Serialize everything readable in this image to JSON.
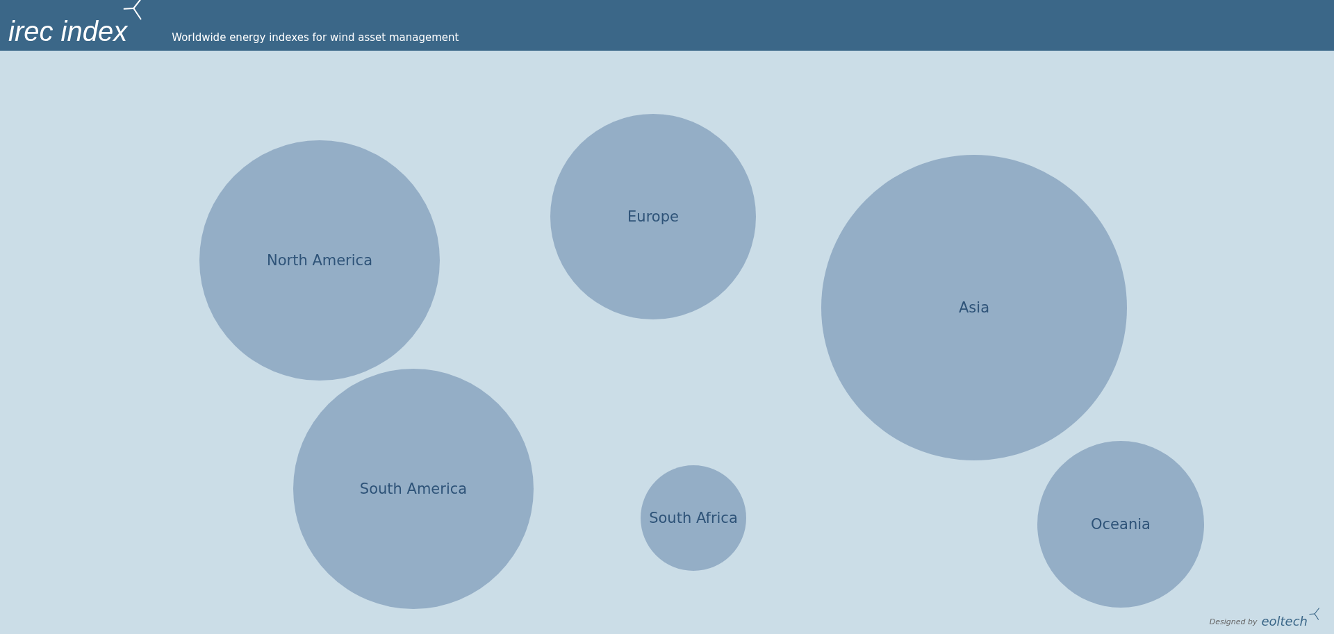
{
  "header": {
    "logo": "irec index",
    "tagline": "Worldwide energy indexes for wind asset management"
  },
  "map": {
    "regions": [
      {
        "label": "North America"
      },
      {
        "label": "Europe"
      },
      {
        "label": "Asia"
      },
      {
        "label": "South America"
      },
      {
        "label": "South Africa"
      },
      {
        "label": "Oceania"
      }
    ]
  },
  "footer": {
    "credit_prefix": "Designed by",
    "credit_brand": "eoltech"
  }
}
